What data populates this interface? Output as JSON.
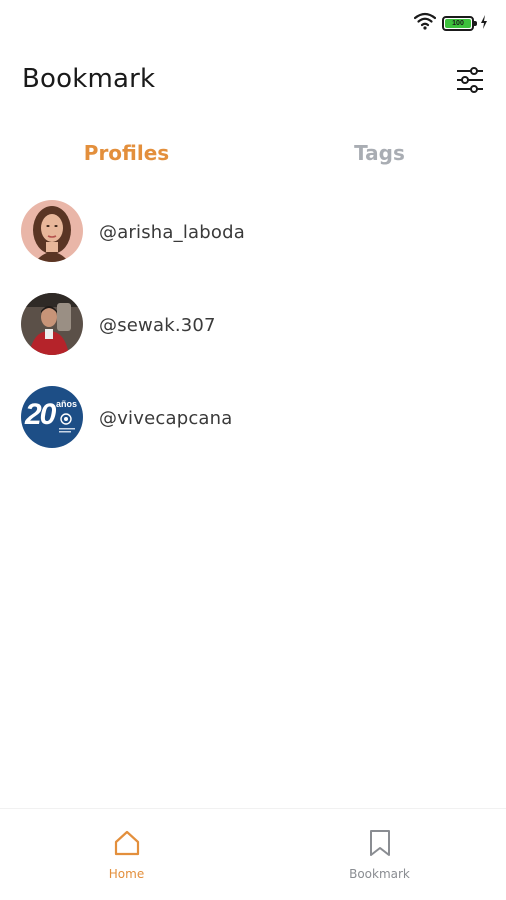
{
  "status_bar": {
    "battery_level": "100",
    "icons": [
      "wifi-icon",
      "battery-icon",
      "charging-icon"
    ]
  },
  "header": {
    "title": "Bookmark",
    "filter_icon": "sliders-icon"
  },
  "tabs": [
    {
      "label": "Profiles",
      "active": true
    },
    {
      "label": "Tags",
      "active": false
    }
  ],
  "profiles": [
    {
      "handle": "@arisha_laboda"
    },
    {
      "handle": "@sewak.307"
    },
    {
      "handle": "@vivecapcana",
      "avatar_text": "20",
      "avatar_subtext": "años"
    }
  ],
  "bottom_nav": {
    "items": [
      {
        "label": "Home",
        "icon": "home-icon",
        "active": true
      },
      {
        "label": "Bookmark",
        "icon": "bookmark-icon",
        "active": false
      }
    ]
  },
  "colors": {
    "accent": "#e38f3c",
    "inactive": "#a9adb3",
    "battery": "#3cc13b"
  }
}
